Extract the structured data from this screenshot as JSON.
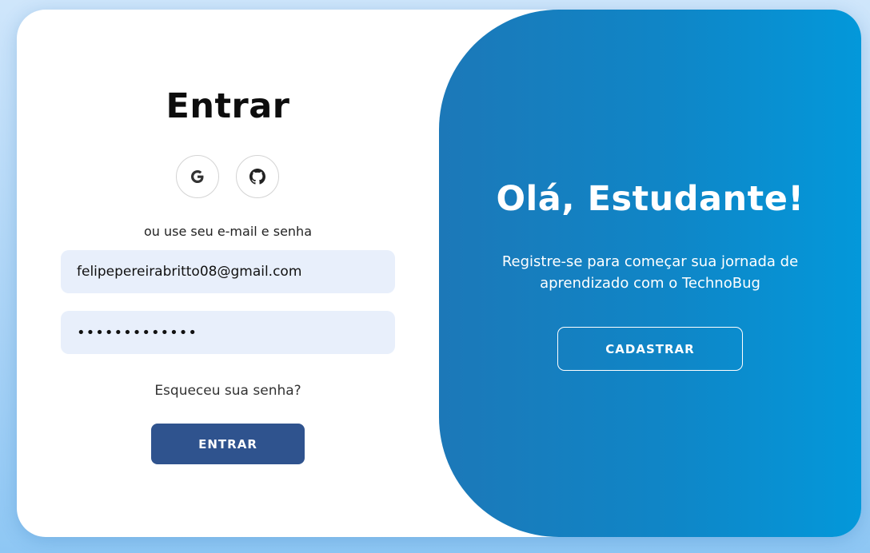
{
  "login": {
    "title": "Entrar",
    "social": [
      {
        "name": "google-icon",
        "label": "G"
      },
      {
        "name": "github-icon"
      }
    ],
    "alt_text": "ou use seu e-mail e senha",
    "email_value": "felipepereirabritto08@gmail.com",
    "password_value": "•••••••••••••",
    "forgot": "Esqueceu sua senha?",
    "submit_label": "ENTRAR"
  },
  "panel": {
    "title": "Olá, Estudante!",
    "subtitle": "Registre-se para começar sua jornada de aprendizado com o TechnoBug",
    "register_label": "CADASTRAR"
  },
  "colors": {
    "primary_button": "#2f538e",
    "panel_gradient_start": "#1c78b8",
    "panel_gradient_end": "#0398da",
    "input_background": "#e8effb"
  }
}
